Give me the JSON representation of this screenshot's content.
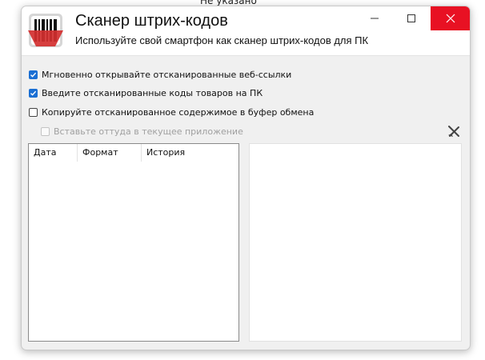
{
  "background": {
    "caption": "Не указано"
  },
  "app": {
    "title": "Сканер штрих-кодов",
    "subtitle": "Используйте свой смартфон как сканер штрих-кодов для ПК",
    "accent_color": "#d32f2f"
  },
  "window_controls": {
    "close_color": "#e81123"
  },
  "options": [
    {
      "label": "Мгновенно открывайте отсканированные веб-ссылки",
      "checked": true,
      "enabled": true
    },
    {
      "label": "Введите отсканированные коды товаров на ПК",
      "checked": true,
      "enabled": true
    },
    {
      "label": "Копируйте отсканированное содержимое в буфер обмена",
      "checked": false,
      "enabled": true
    },
    {
      "label": "Вставьте оттуда в текущее приложение",
      "checked": false,
      "enabled": false
    }
  ],
  "history": {
    "columns": [
      "Дата",
      "Формат",
      "История"
    ],
    "rows": []
  }
}
